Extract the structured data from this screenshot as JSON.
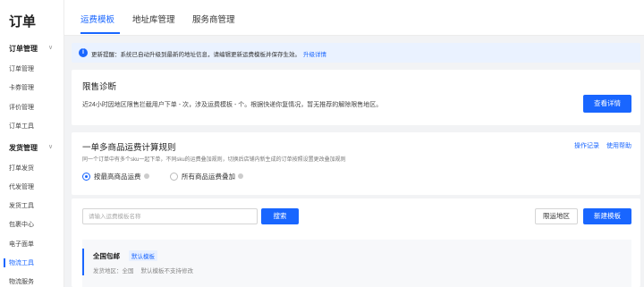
{
  "sidebar": {
    "title": "订单",
    "groups": [
      {
        "label": "订单管理",
        "items": [
          "订单管理",
          "卡券管理",
          "评价管理",
          "订单工具"
        ]
      },
      {
        "label": "发货管理",
        "items": [
          "打单发货",
          "代发管理",
          "发货工具",
          "包裹中心",
          "电子面单",
          "物流工具",
          "物流服务"
        ]
      }
    ],
    "active_item": "物流工具"
  },
  "tabs": [
    {
      "label": "运费模板",
      "active": true
    },
    {
      "label": "地址库管理",
      "active": false
    },
    {
      "label": "服务商管理",
      "active": false
    }
  ],
  "notice": {
    "text": "更新提醒：系统已自动升级到最新的地址信息，请编辑更新运费模板并保存生效。",
    "link": "升级详情"
  },
  "limit_card": {
    "title": "限售诊断",
    "desc": "近24小时因地区限售拦截用户下单 - 次，涉及运费模板 - 个。根据快递你复情况，暂无推荐的解除限售地区。",
    "button": "查看详情"
  },
  "rule_card": {
    "title": "一单多商品运费计算规则",
    "links": [
      "操作记录",
      "使用帮助"
    ],
    "desc": "同一个订单中有多个sku一起下单，不同sku的运费叠加规则，切换后店铺内新生成的订单按照设置更改叠加规则",
    "options": [
      {
        "label": "按最高商品运费",
        "selected": true
      },
      {
        "label": "所有商品运费叠加",
        "selected": false
      }
    ]
  },
  "template_card": {
    "search_placeholder": "请输入运费模板名称",
    "search_button": "搜索",
    "limit_region_button": "限运地区",
    "new_button": "新建模板",
    "template": {
      "name": "全国包邮",
      "badge": "默认模板",
      "region": "发货地区：全国",
      "note": "默认模板不支持修改"
    }
  },
  "colors": {
    "accent": "#1966ff",
    "notice_bg": "#eaf2ff",
    "page_bg": "#f2f3f5"
  }
}
